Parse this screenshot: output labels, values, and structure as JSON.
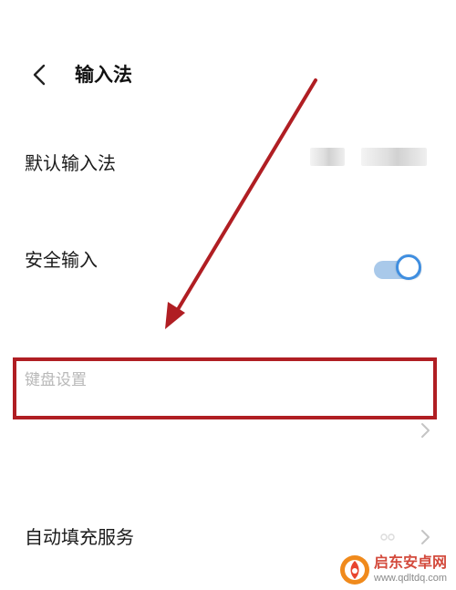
{
  "header": {
    "title": "输入法",
    "back_icon": "chevron-left-icon"
  },
  "settings": {
    "default_input_method": {
      "label": "默认输入法",
      "value_note": "value obscured by blur"
    },
    "secure_input": {
      "label": "安全输入",
      "toggle_state": "on"
    },
    "keyboard_settings": {
      "label": "键盘设置",
      "highlighted": true
    },
    "autofill_service": {
      "label": "自动填充服务"
    }
  },
  "watermark": {
    "name": "启东安卓网",
    "url": "www.qdltdq.com"
  },
  "colors": {
    "background": "#ffffff",
    "text_primary": "#1a1a1a",
    "text_muted": "#b8b8b8",
    "toggle_track": "#a9c9ea",
    "toggle_knob_border": "#3f8ee0",
    "annotation_red": "#b01e23",
    "watermark_red": "#d34a3c"
  }
}
